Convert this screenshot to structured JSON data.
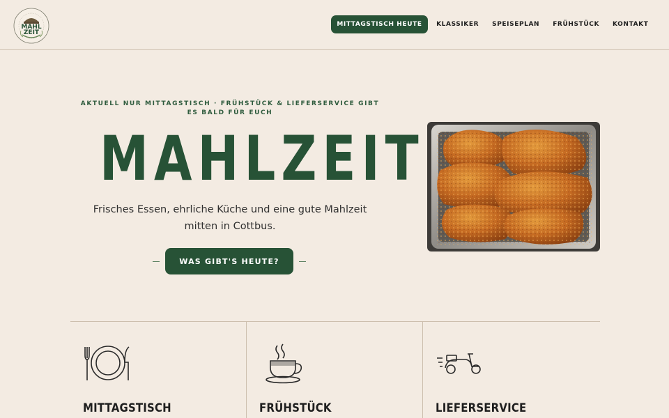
{
  "brand": {
    "logo_text_top": "MAHL",
    "logo_text_bottom": "ZEIT",
    "logo_ring_text": "MITTAGSTISCH · COTTBUS"
  },
  "nav": {
    "items": [
      {
        "label": "MITTAGSTISCH HEUTE",
        "active": true
      },
      {
        "label": "KLASSIKER"
      },
      {
        "label": "SPEISEPLAN"
      },
      {
        "label": "FRÜHSTÜCK"
      },
      {
        "label": "KONTAKT"
      }
    ]
  },
  "hero": {
    "eyebrow": "AKTUELL NUR MITTAGSTISCH · FRÜHSTÜCK & LIEFERSERVICE GIBT ES BALD FÜR EUCH",
    "title": "MAHLZEIT!",
    "subtitle": "Frisches Essen, ehrliche Küche und eine gute Mahlzeit mitten in Cottbus.",
    "cta": "WAS GIBT'S HEUTE?"
  },
  "features": [
    {
      "title": "MITTAGSTISCH",
      "icon": "plate-cutlery-icon"
    },
    {
      "title": "FRÜHSTÜCK",
      "icon": "coffee-cup-icon"
    },
    {
      "title": "LIEFERSERVICE",
      "icon": "scooter-icon"
    }
  ],
  "colors": {
    "background": "#f3ebe2",
    "brand_green": "#275236",
    "divider": "#cdbfae"
  }
}
